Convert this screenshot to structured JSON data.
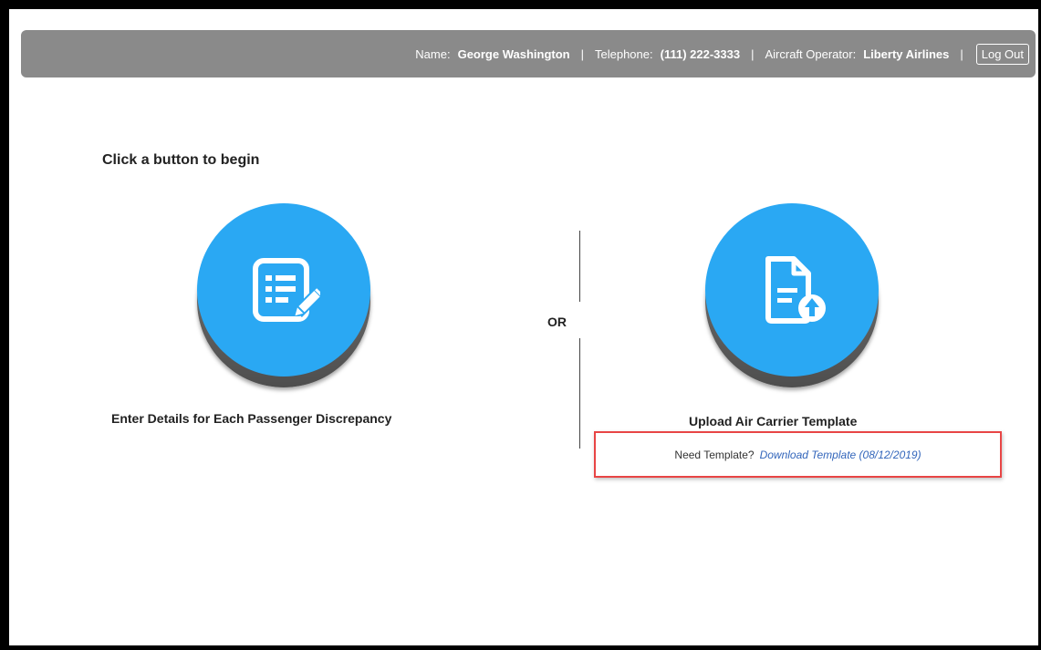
{
  "header": {
    "name_label": "Name:",
    "name_value": "George Washington",
    "separator": "|",
    "telephone_label": "Telephone:",
    "telephone_value": "(111) 222-3333",
    "operator_label": "Aircraft Operator:",
    "operator_value": "Liberty Airlines",
    "logout_label": "Log Out"
  },
  "main": {
    "prompt": "Click a button to begin",
    "or_text": "OR",
    "enter_details": {
      "icon": "list-edit-icon",
      "caption": "Enter Details for Each Passenger Discrepancy"
    },
    "upload": {
      "icon": "document-upload-icon",
      "caption": "Upload Air Carrier Template"
    },
    "template": {
      "need_text": "Need Template?",
      "download_link": "Download Template (08/12/2019)"
    }
  },
  "colors": {
    "accent": "#2aa8f3",
    "header_bg": "#8a8a8a",
    "highlight_border": "#e84545",
    "link": "#3366bb"
  }
}
